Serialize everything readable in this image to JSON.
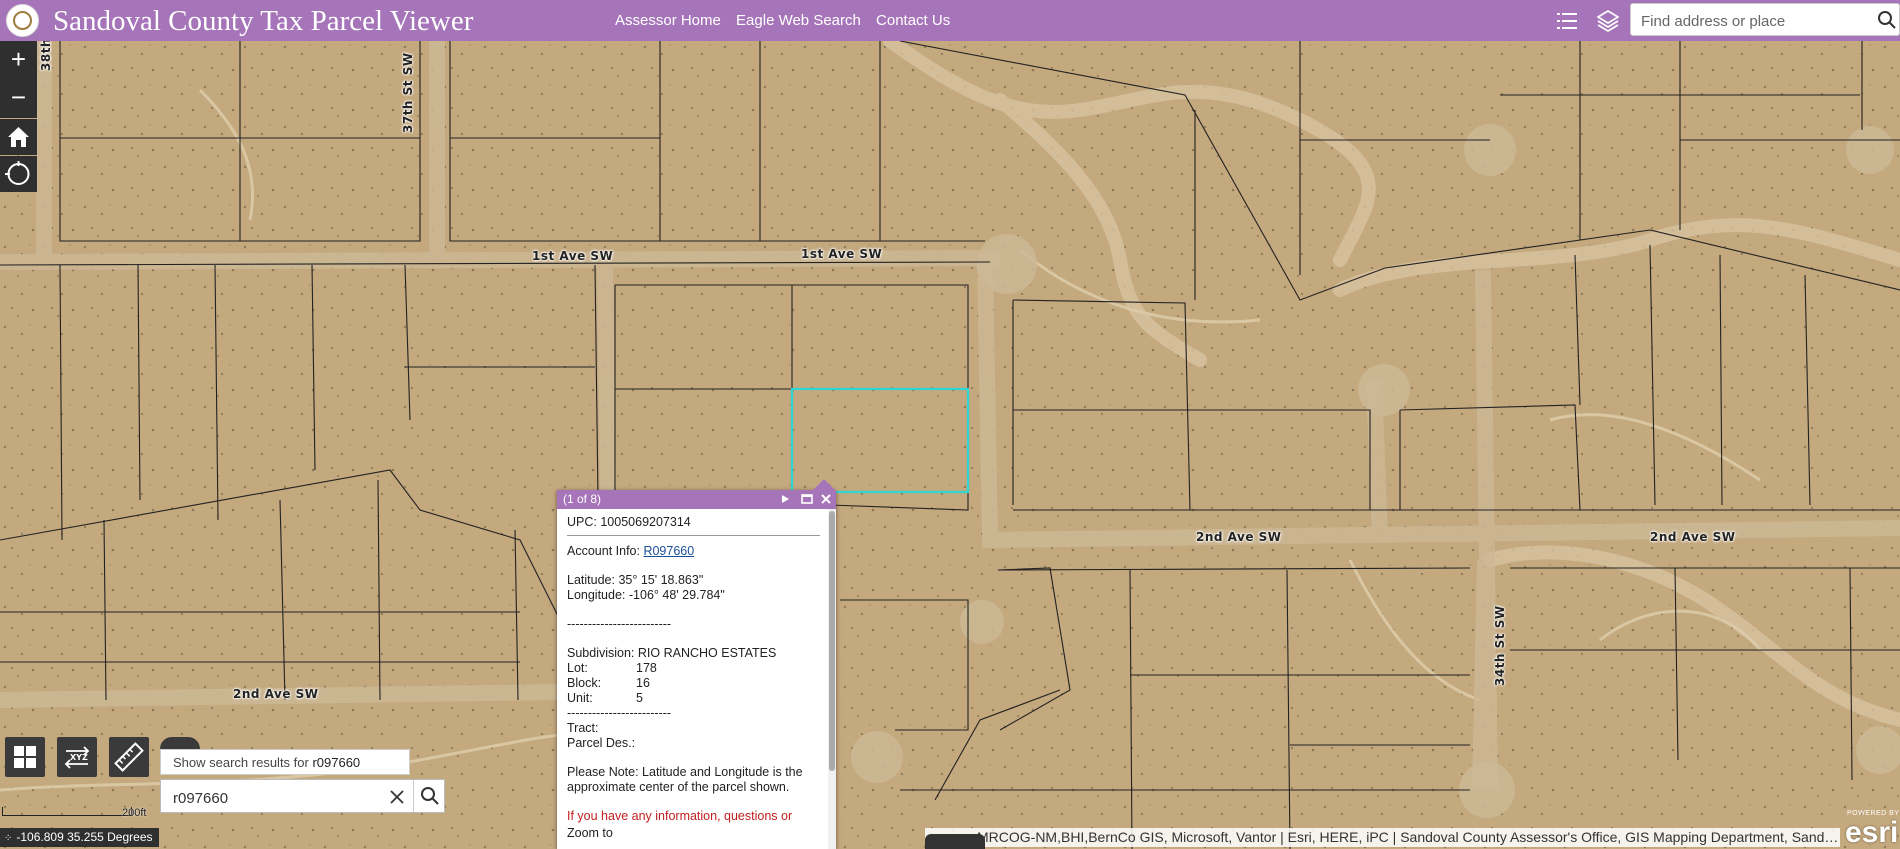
{
  "header": {
    "title": "Sandoval County Tax Parcel Viewer",
    "nav": [
      "Assessor Home",
      "Eagle Web Search",
      "Contact Us"
    ],
    "search_placeholder": "Find address or place",
    "accent": "#a674b8"
  },
  "map": {
    "road_labels": [
      "1st Ave SW",
      "1st Ave SW",
      "2nd Ave SW",
      "2nd Ave SW",
      "2nd Ave SW",
      "37th St SW",
      "34th St SW",
      "38th"
    ],
    "selected_parcel_color": "#2fd6d6",
    "scale_label": "200ft",
    "coordinates": "-106.809 35.255 Degrees",
    "attribution": "MRCOG-NM,BHI,BernCo GIS, Microsoft, Vantor | Esri, HERE, iPC | Sandoval County Assessor's Office, GIS Mapping Department, Sandova...",
    "esri_small": "POWERED BY",
    "esri_big": "esri"
  },
  "controls": {
    "zoom_in": "+",
    "zoom_out": "−",
    "icons": [
      "home-icon",
      "locate-icon",
      "basemap-gallery-icon",
      "coordinate-conversion-icon",
      "measure-icon",
      "search-icon",
      "layer-list-icon",
      "layers-icon"
    ]
  },
  "search": {
    "suggestion_prefix": "Show search results for ",
    "suggestion_term": "r097660",
    "value": "r097660"
  },
  "popup": {
    "counter": "(1 of 8)",
    "upc_label": "UPC:",
    "upc_value": "1005069207314",
    "account_label": "Account Info:",
    "account_value": "R097660",
    "latitude_label": "Latitude:",
    "latitude_value": "35° 15' 18.863\"",
    "longitude_label": "Longitude:",
    "longitude_value": "-106° 48' 29.784\"",
    "divider": "-------------------------",
    "subdivision_label": "Subdivision:",
    "subdivision_value": "RIO RANCHO ESTATES",
    "lot_label": "Lot:",
    "lot_value": "178",
    "block_label": "Block:",
    "block_value": "16",
    "unit_label": "Unit:",
    "unit_value": "5",
    "tract_label": "Tract:",
    "parcel_des_label": "Parcel Des.:",
    "note": "Please Note: Latitude and Longitude is the approximate center of the parcel shown.",
    "red_text": "If you have any information, questions or",
    "zoom_to": "Zoom to"
  }
}
